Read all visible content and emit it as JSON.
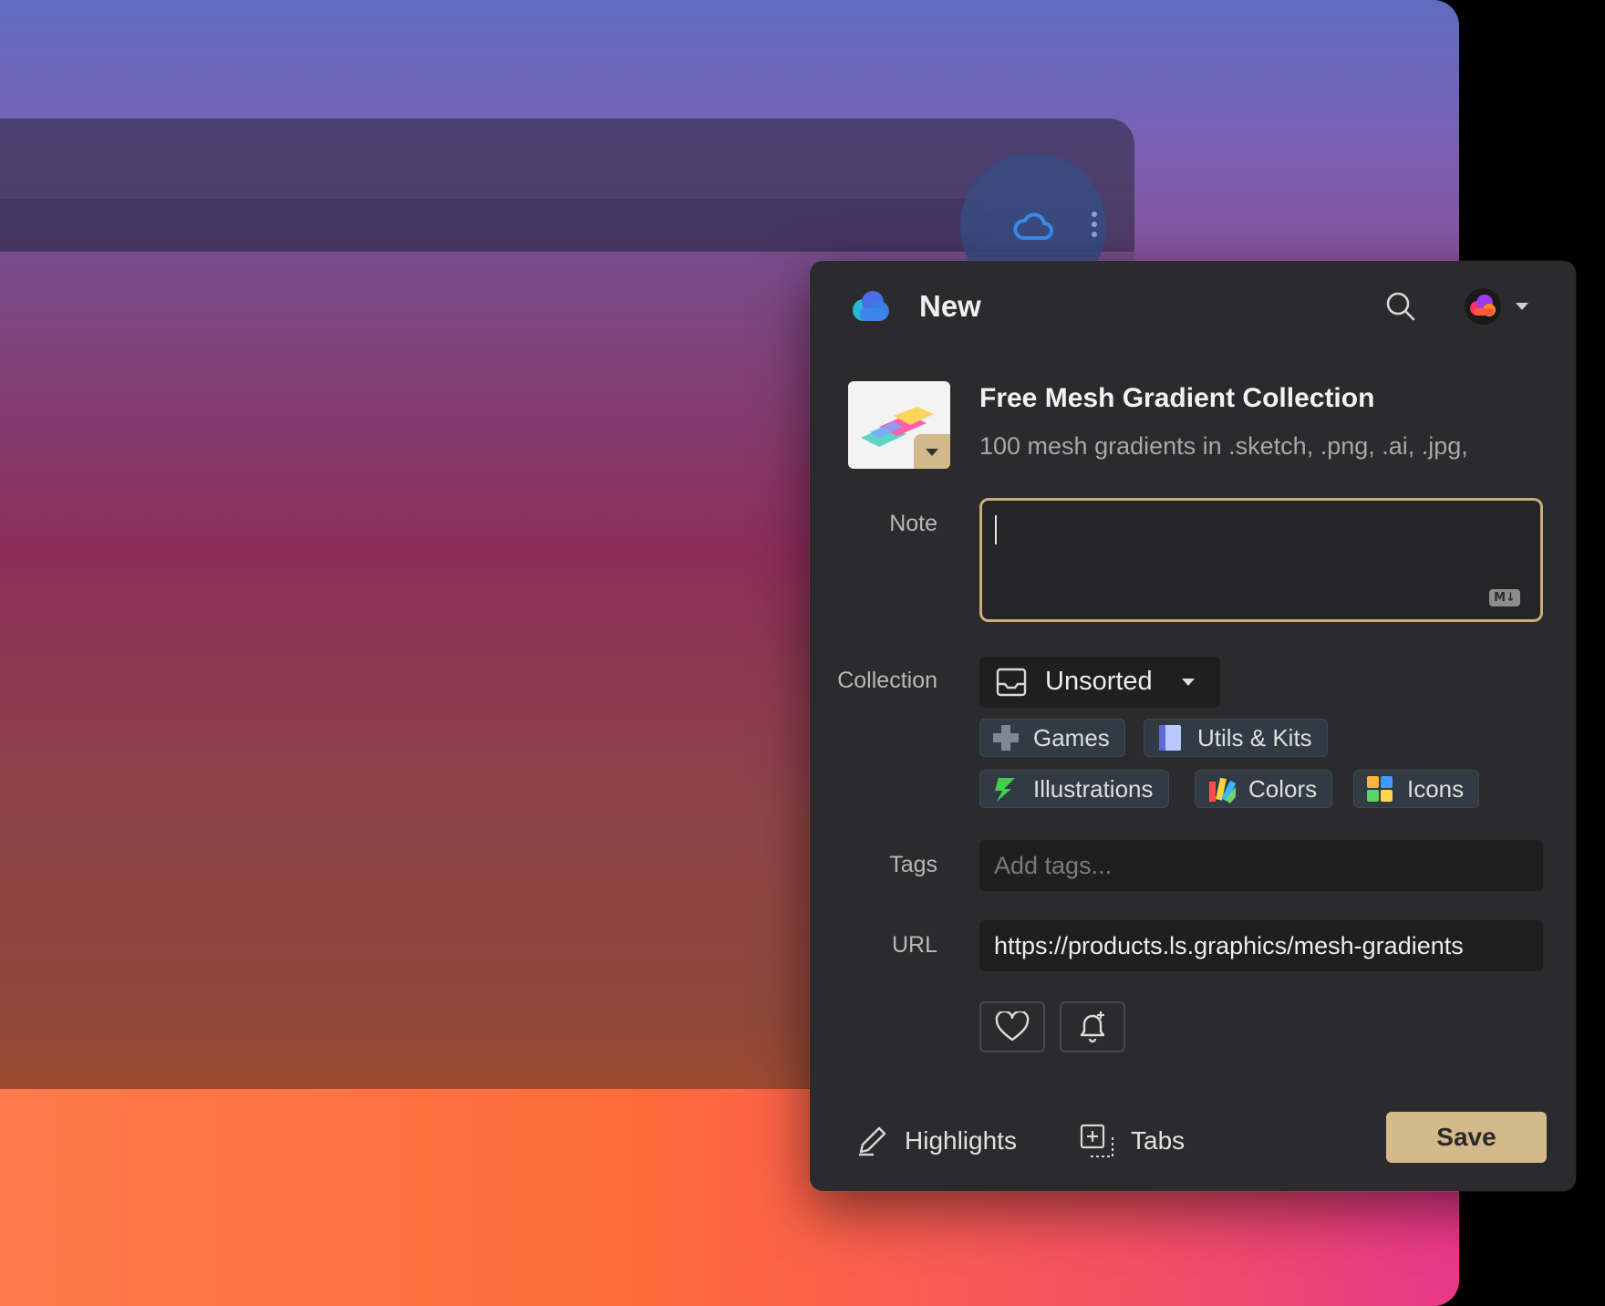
{
  "popup": {
    "title": "New",
    "item": {
      "title": "Free Mesh Gradient Collection",
      "description": "100 mesh gradients in .sketch, .png, .ai, .jpg,"
    },
    "note": {
      "label": "Note",
      "value": "",
      "markdown_badge": "M↓"
    },
    "collection": {
      "label": "Collection",
      "selected": "Unsorted",
      "icon": "inbox-icon",
      "suggestions": [
        {
          "label": "Games",
          "icon": "game-cross-icon"
        },
        {
          "label": "Utils & Kits",
          "icon": "book-icon"
        },
        {
          "label": "Illustrations",
          "icon": "illustration-icon"
        },
        {
          "label": "Colors",
          "icon": "palette-icon"
        },
        {
          "label": "Icons",
          "icon": "icons-grid-icon"
        }
      ]
    },
    "tags": {
      "label": "Tags",
      "placeholder": "Add tags..."
    },
    "url": {
      "label": "URL",
      "value": "https://products.ls.graphics/mesh-gradients"
    },
    "actions": {
      "favorite_icon": "heart-icon",
      "reminder_icon": "bell-plus-icon"
    },
    "footer": {
      "highlights_label": "Highlights",
      "tabs_label": "Tabs",
      "save_label": "Save"
    }
  },
  "colors": {
    "accent": "#d4b98a",
    "panel": "#2b2a2c",
    "field": "#1f1f20",
    "extension_icon": "#3b8bea"
  }
}
